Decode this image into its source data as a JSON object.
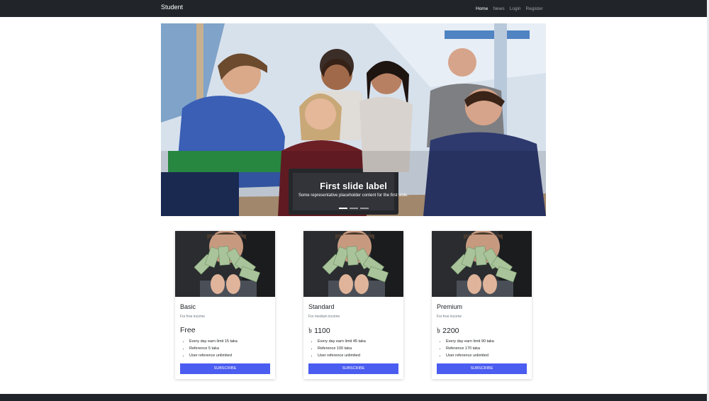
{
  "navbar": {
    "brand": "Student",
    "links": [
      "Home",
      "News",
      "Login",
      "Register"
    ],
    "active": "Home"
  },
  "carousel": {
    "title": "First slide label",
    "text": "Some representative placeholder content for the first slide.",
    "slides": 3,
    "active_slide": 1
  },
  "plans": [
    {
      "name": "Basic",
      "subtitle": "For free income",
      "price": "Free",
      "features": [
        "Every day earn limit 15 taka",
        "Reference 5 taka",
        "User reference unlimited"
      ],
      "button": "SUBSCRIBE"
    },
    {
      "name": "Standard",
      "subtitle": "For medium income",
      "price": "৳ 1100",
      "features": [
        "Every day earn limit 45 taka",
        "Reference 100 taka",
        "User reference unlimited"
      ],
      "button": "SUBSCRIBE"
    },
    {
      "name": "Premium",
      "subtitle": "For free income",
      "price": "৳ 2200",
      "features": [
        "Every day earn limit 90 taka",
        "Reference 170 taka",
        "User reference unlimited"
      ],
      "button": "SUBSCRIBE"
    }
  ],
  "colors": {
    "navbar": "#212529",
    "button": "#4b5cf0",
    "footer": "#212529"
  }
}
